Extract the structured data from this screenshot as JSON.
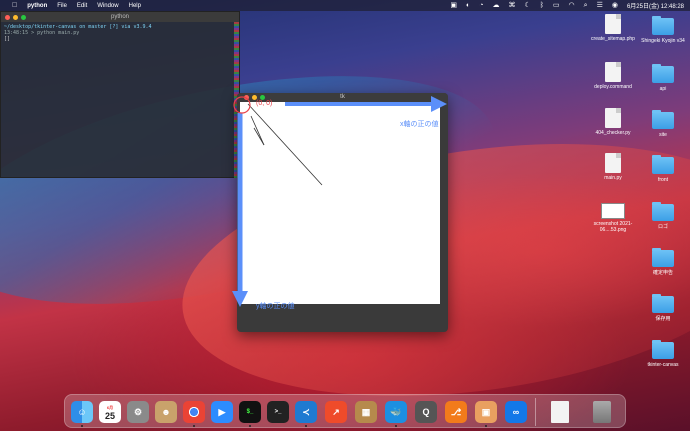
{
  "menubar": {
    "app": "python",
    "items": [
      "File",
      "Edit",
      "Window",
      "Help"
    ],
    "clock": "6月25日(金)  12:48:28"
  },
  "terminal": {
    "title": "python",
    "lines": [
      "~/desktop/tkinter-canvas on  master [?] via  v3.9.4",
      "13:48:15 > python main.py",
      "[]"
    ]
  },
  "tk": {
    "title": "tk",
    "origin_label": "(0, 0)",
    "x_label": "x軸の正の値",
    "y_label": "y軸の正の値"
  },
  "desktop": [
    {
      "label": "create_sitemap.php",
      "kind": "file",
      "tag": "PHP"
    },
    {
      "label": "Shingeki Kyojin v34",
      "kind": "folder"
    },
    {
      "label": "deploy.command",
      "kind": "file",
      "tag": "EXEC"
    },
    {
      "label": "api",
      "kind": "folder"
    },
    {
      "label": "404_checker.py",
      "kind": "file",
      "tag": "PY"
    },
    {
      "label": "site",
      "kind": "folder"
    },
    {
      "label": "main.py",
      "kind": "file",
      "tag": "PY"
    },
    {
      "label": "front",
      "kind": "folder"
    },
    {
      "label": "screenshot 2021-06....53.png",
      "kind": "image"
    },
    {
      "label": "ロゴ",
      "kind": "folder"
    },
    {
      "label": "確定申告",
      "kind": "folder"
    },
    {
      "label": "保存用",
      "kind": "folder"
    },
    {
      "label": "tkinter-canvas",
      "kind": "folder"
    }
  ],
  "dock": {
    "calendar_month": "6月",
    "calendar_day": "25",
    "apps": [
      "finder-icon",
      "calendar-icon",
      "system-preferences-icon",
      "contacts-icon",
      "chrome-icon",
      "zoom-icon",
      "iterm-icon",
      "terminal-icon",
      "vscode-icon",
      "instruments-icon",
      "archive-utility-icon",
      "docker-icon",
      "quicktime-icon",
      "sourcetree-icon",
      "preview-icon",
      "infinity-icon",
      "document-icon",
      "trash-icon"
    ]
  },
  "colors": {
    "arrow": "#5b8ff9",
    "origin_circle": "#e8424a",
    "folder": "#4aa6ec"
  }
}
